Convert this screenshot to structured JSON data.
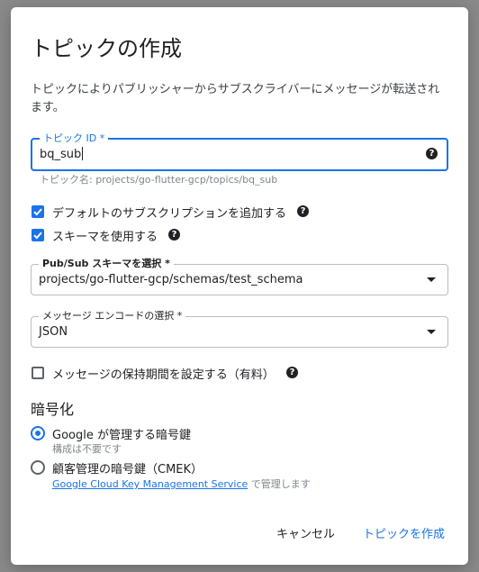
{
  "dialog": {
    "title": "トピックの作成",
    "description": "トピックによりパブリッシャーからサブスクライバーにメッセージが転送されます。"
  },
  "topic_id": {
    "label": "トピック ID *",
    "value": "bq_sub",
    "hint": "トピック名: projects/go-flutter-gcp/topics/bq_sub"
  },
  "options": {
    "default_subscription": {
      "label": "デフォルトのサブスクリプションを追加する",
      "checked": true
    },
    "use_schema": {
      "label": "スキーマを使用する",
      "checked": true
    },
    "retention": {
      "label": "メッセージの保持期間を設定する（有料）",
      "checked": false
    }
  },
  "schema_select": {
    "label": "Pub/Sub スキーマを選択 *",
    "value": "projects/go-flutter-gcp/schemas/test_schema"
  },
  "encoding_select": {
    "label": "メッセージ エンコードの選択 *",
    "value": "JSON"
  },
  "encryption": {
    "heading": "暗号化",
    "google_managed": {
      "label": "Google が管理する暗号鍵",
      "sub": "構成は不要です",
      "selected": true
    },
    "cmek": {
      "label": "顧客管理の暗号鍵（CMEK）",
      "link": "Google Cloud Key Management Service",
      "sub_suffix": " で管理します",
      "selected": false
    }
  },
  "actions": {
    "cancel": "キャンセル",
    "create": "トピックを作成"
  },
  "colors": {
    "accent": "#1a73e8",
    "text": "#202124",
    "hint": "#80868b"
  },
  "icons": {
    "help": "help-icon",
    "dropdown": "dropdown-arrow-icon",
    "check": "check-icon"
  }
}
